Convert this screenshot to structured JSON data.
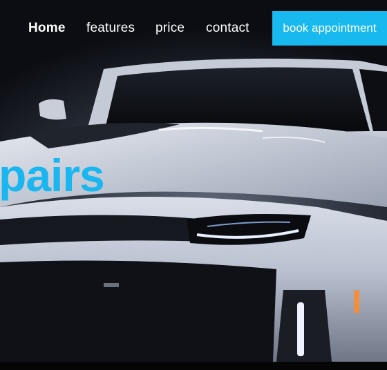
{
  "nav": {
    "items": [
      {
        "label": "Home",
        "active": true
      },
      {
        "label": "features",
        "active": false
      },
      {
        "label": "price",
        "active": false
      },
      {
        "label": "contact",
        "active": false
      }
    ],
    "cta_label": "book appointment"
  },
  "hero": {
    "headline": "pairs",
    "image": "white-sports-car-front-view"
  },
  "colors": {
    "accent": "#18b9ef",
    "nav_text": "#ffffff",
    "background": "#000000"
  }
}
